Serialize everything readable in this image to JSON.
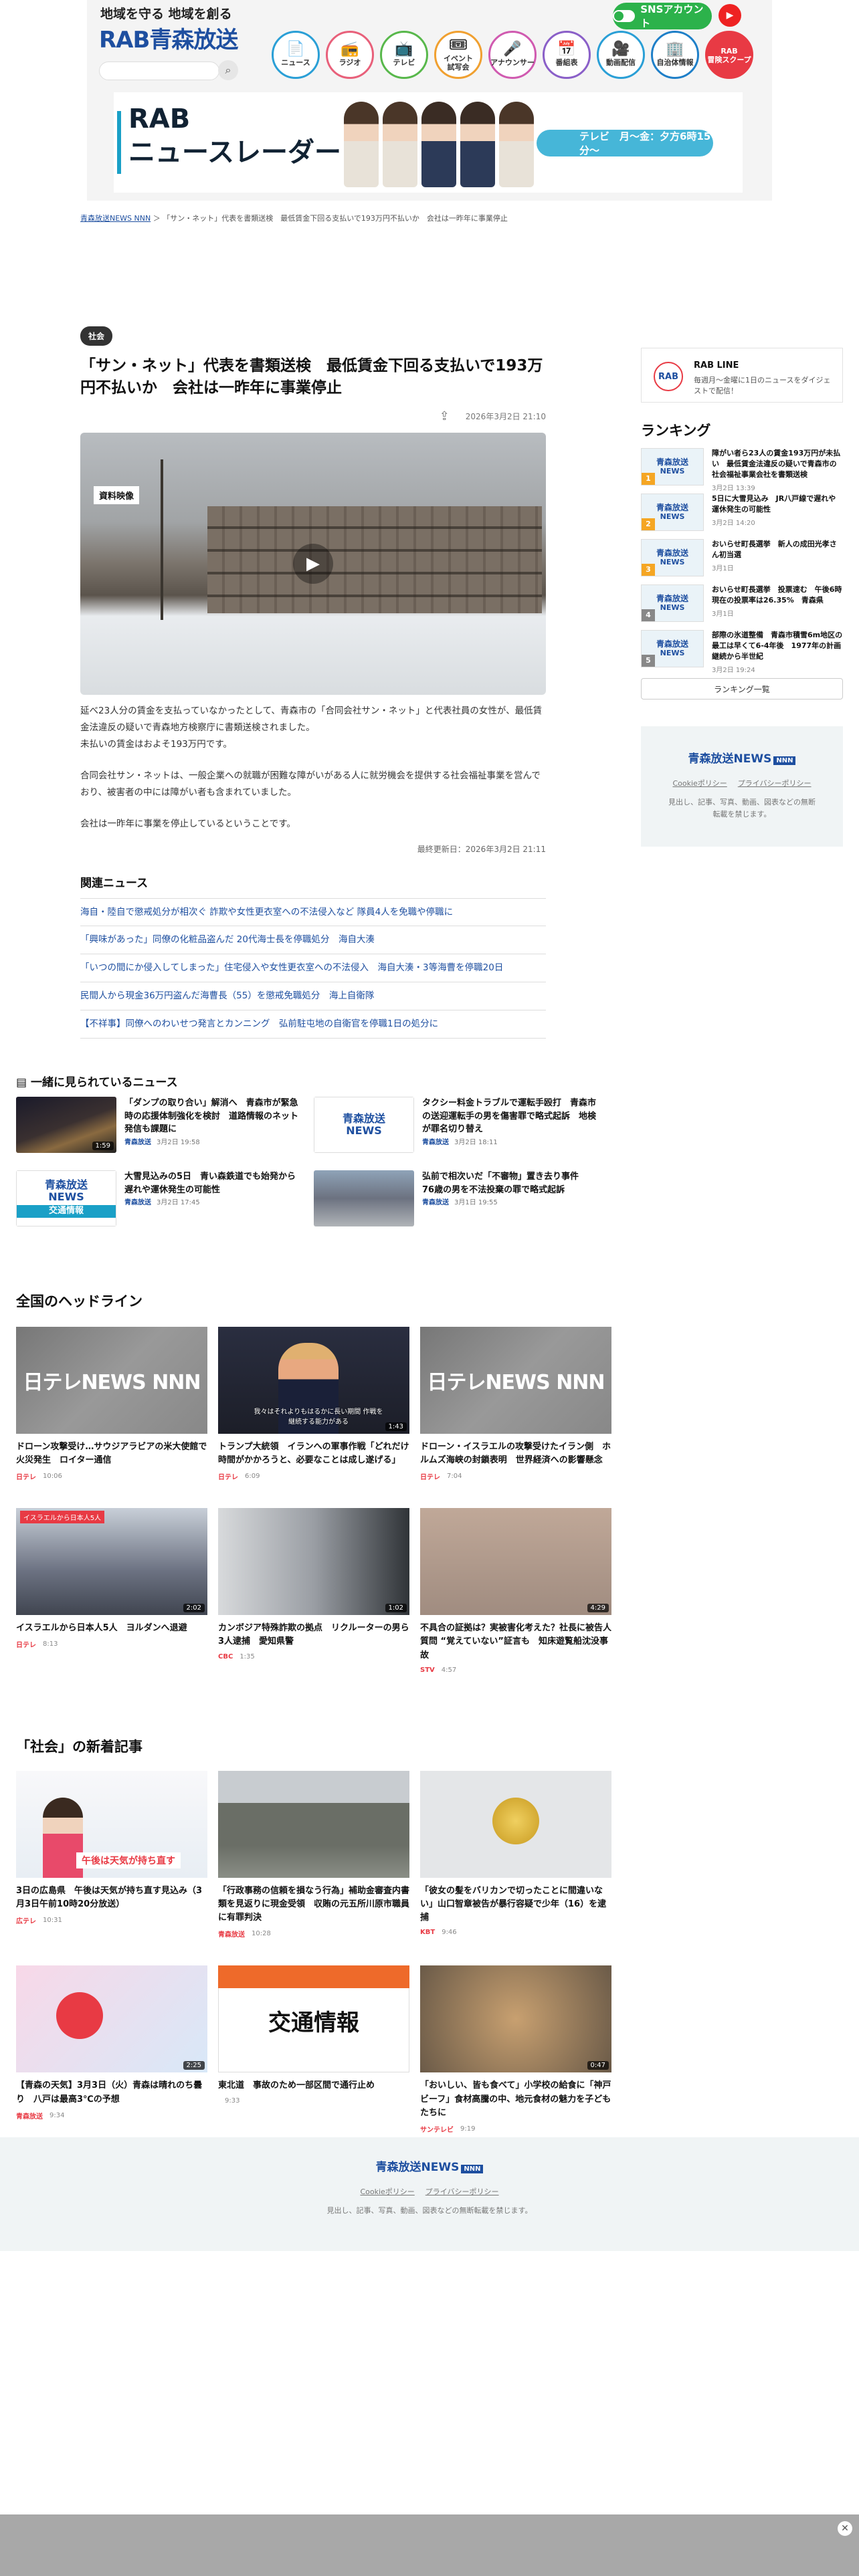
{
  "header": {
    "tagline": "地域を守る 地域を創る",
    "logo": "RAB青森放送",
    "sns_label": "SNSアカウント",
    "nav": [
      {
        "label": "ニュース",
        "icon": "📄",
        "color": "#2a9fd6"
      },
      {
        "label": "ラジオ",
        "icon": "📻",
        "color": "#e8607a"
      },
      {
        "label": "テレビ",
        "icon": "📺",
        "color": "#58b84b"
      },
      {
        "label": "イベント\n試写会",
        "icon": "🎟",
        "color": "#f0a030"
      },
      {
        "label": "アナウンサー",
        "icon": "🎤",
        "color": "#d05ab0"
      },
      {
        "label": "番組表",
        "icon": "📅",
        "color": "#8a5fc8"
      },
      {
        "label": "動画配信",
        "icon": "🎥",
        "color": "#2a9fd6"
      },
      {
        "label": "自治体情報",
        "icon": "🏢",
        "color": "#1e7fc8"
      },
      {
        "label": "RAB\n冒険スクープ",
        "icon": "",
        "color": "#e83a44"
      }
    ],
    "promo_title_1": "RAB",
    "promo_title_2": "ニュースレーダー",
    "promo_air": "テレビ　月〜金：夕方6時15分〜"
  },
  "breadcrumb": {
    "home": "青森放送NEWS NNN",
    "current": "「サン・ネット」代表を書類送検　最低賃金下回る支払いで193万円不払いか　会社は一昨年に事業停止"
  },
  "article": {
    "category": "社会",
    "title": "「サン・ネット」代表を書類送検　最低賃金下回る支払いで193万円不払いか　会社は一昨年に事業停止",
    "date": "2026年3月2日 21:10",
    "video_label": "資料映像",
    "paragraphs": [
      "延べ23人分の賃金を支払っていなかったとして、青森市の「合同会社サン・ネット」と代表社員の女性が、最低賃金法違反の疑いで青森地方検察庁に書類送検されました。",
      "未払いの賃金はおよそ193万円です。",
      "合同会社サン・ネットは、一般企業への就職が困難な障がいがある人に就労機会を提供する社会福祉事業を営んでおり、被害者の中には障がい者も含まれていました。",
      "会社は一昨年に事業を停止しているということです。"
    ],
    "updated": "最終更新日：2026年3月2日 21:11",
    "related_heading": "関連ニュース",
    "related": [
      "海自・陸自で懲戒処分が相次ぐ 詐欺や女性更衣室への不法侵入など 隊員4人を免職や停職に",
      "「興味があった」同僚の化粧品盗んだ 20代海士長を停職処分　海自大湊",
      "「いつの間にか侵入してしまった」住宅侵入や女性更衣室への不法侵入　海自大湊・3等海曹を停職20日",
      "民間人から現金36万円盗んだ海曹長（55）を懲戒免職処分　海上自衛隊",
      "【不祥事】同僚へのわいせつ発言とカンニング　弘前駐屯地の自衛官を停職1日の処分に"
    ]
  },
  "sidebar": {
    "rabline_name": "RAB LINE",
    "rabline_desc": "毎週月〜金曜に1日のニュースをダイジェストで配信！",
    "ranking_heading": "ランキング",
    "ranking": [
      {
        "rank": "1",
        "title": "障がい者ら23人の賃金193万円が未払い　最低賃金法違反の疑いで青森市の社会福祉事業会社を書類送検",
        "date": "3月2日 13:39"
      },
      {
        "rank": "2",
        "title": "5日に大雪見込み　JR八戸線で遅れや運休発生の可能性",
        "date": "3月2日 14:20"
      },
      {
        "rank": "3",
        "title": "おいらせ町長選挙　新人の成田光孝さん初当選",
        "date": "3月1日"
      },
      {
        "rank": "4",
        "title": "おいらせ町長選挙　投票速む　午後6時現在の投票率は26.35%　青森県",
        "date": "3月1日"
      },
      {
        "rank": "5",
        "title": "部際の氷道整備　青森市積雪6m地区の最工は早くて6-4年後　1977年の計画継続から半世紀",
        "date": "3月2日 19:24"
      }
    ],
    "ranking_all": "ランキング一覧",
    "foot_logo": "青森放送NEWS",
    "foot_badge": "NNN",
    "cookie": "Cookieポリシー",
    "privacy": "プライバシーポリシー",
    "note": "見出し、記事、写真、動画、図表などの無断転載を禁じます。"
  },
  "watched": {
    "heading": "一緒に見られているニュース",
    "items": [
      {
        "title": "「ダンプの取り合い」解消へ　青森市が緊急時の応援体制強化を検討　道路情報のネット発信も課題に",
        "src": "青森放送",
        "date": "3月2日 19:58",
        "duration": "1:59",
        "thumb": "night"
      },
      {
        "title": "タクシー料金トラブルで運転手殴打　青森市の送迎運転手の男を傷害罪で略式起訴　地検が罪名切り替え",
        "src": "青森放送",
        "date": "3月2日 18:11",
        "duration": "",
        "thumb": "rab"
      },
      {
        "title": "大雪見込みの5日　青い森鉄道でも始発から遅れや運休発生の可能性",
        "src": "青森放送",
        "date": "3月2日 17:45",
        "duration": "",
        "thumb": "rabtraffic"
      },
      {
        "title": "弘前で相次いだ「不審物」置き去り事件　76歳の男を不法投棄の罪で略式起訴",
        "src": "青森放送",
        "date": "3月1日 19:55",
        "duration": "",
        "thumb": "street"
      }
    ]
  },
  "national": {
    "heading": "全国のヘッドライン",
    "items": [
      {
        "title": "ドローン攻撃受け…サウジアラビアの米大使館で火災発生　ロイター通信",
        "src": "日テレ",
        "date": "10:06",
        "duration": "",
        "thumb": "ntv"
      },
      {
        "title": "トランプ大統領　イランへの軍事作戦「どれだけ時間がかかろうと、必要なことは成し遂げる」",
        "src": "日テレ",
        "date": "6:09",
        "duration": "1:43",
        "thumb": "trump",
        "caption": "我々はそれよりもはるかに長い期間 作戦を継続する能力がある"
      },
      {
        "title": "ドローン・イスラエルの攻撃受けたイラン側　ホルムズ海峡の封鎖表明　世界経済への影響懸念",
        "src": "日テレ",
        "date": "7:04",
        "duration": "",
        "thumb": "ntv"
      },
      {
        "title": "イスラエルから日本人5人　ヨルダンへ退避",
        "src": "日テレ",
        "date": "8:13",
        "duration": "2:02",
        "thumb": "crowd"
      },
      {
        "title": "カンボジア特殊詐欺の拠点　リクルーターの男ら3人逮捕　愛知県警",
        "src": "CBC",
        "date": "1:35",
        "duration": "1:02",
        "thumb": "arrest"
      },
      {
        "title": "不具合の証拠は？実被害化考えた？社長に被告人質問 “覚えていない”証言も　知床遊覧船沈没事故",
        "src": "STV",
        "date": "4:57",
        "duration": "4:29",
        "thumb": "court"
      }
    ]
  },
  "social": {
    "heading": "「社会」の新着記事",
    "items": [
      {
        "title": "3日の広島県　午後は天気が持ち直す見込み（3月3日午前10時20分放送）",
        "src": "広テレ",
        "date": "10:31",
        "duration": "",
        "thumb": "weather"
      },
      {
        "title": "「行政事務の信頼を損なう行為」補助金審査内書類を見返りに現金受領　収賄の元五所川原市職員に有罪判決",
        "src": "青森放送",
        "date": "10:28",
        "duration": "",
        "thumb": "courthouse"
      },
      {
        "title": "「彼女の髪をバリカンで切ったことに間違いない」山口智章被告が暴行容疑で少年（16）を逮捕",
        "src": "KBT",
        "date": "9:46",
        "duration": "",
        "thumb": "emblem"
      },
      {
        "title": "【青森の天気】3月3日（火）青森は晴れのち曇り　八戸は最高3℃の予想",
        "src": "青森放送",
        "date": "9:34",
        "duration": "2:25",
        "thumb": "cartoon"
      },
      {
        "title": "東北道　事故のため一部区間で通行止め",
        "src": "",
        "date": "9:33",
        "duration": "",
        "thumb": "traffic"
      },
      {
        "title": "「おいしい、皆も食べて」小学校の給食に「神戸ビーフ」食材高騰の中、地元食材の魅力を子どもたちに",
        "src": "サンテレビ",
        "date": "9:19",
        "duration": "0:47",
        "thumb": "food"
      }
    ]
  },
  "footer": {
    "logo": "青森放送NEWS",
    "badge": "NNN",
    "cookie": "Cookieポリシー",
    "privacy": "プライバシーポリシー",
    "note": "見出し、記事、写真、動画、図表などの無断転載を禁じます。"
  },
  "colors": {
    "brand": "#1e4fa0",
    "accent": "#e83a44",
    "rank_gold": "#f5a623"
  }
}
